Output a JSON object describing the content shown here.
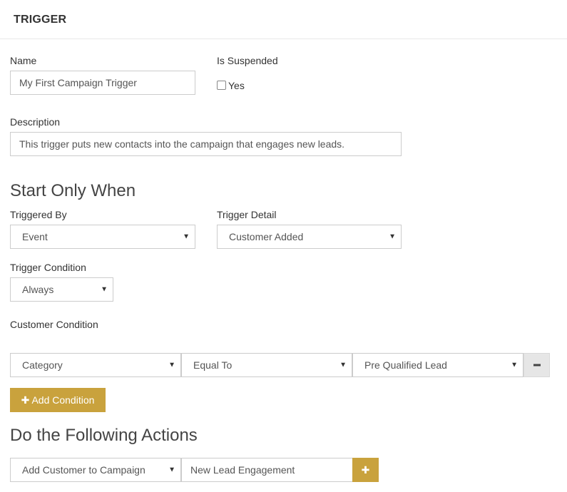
{
  "header": {
    "title": "TRIGGER"
  },
  "form": {
    "name_label": "Name",
    "name_value": "My First Campaign Trigger",
    "suspended_label": "Is Suspended",
    "suspended_option": "Yes",
    "description_label": "Description",
    "description_value": "This trigger puts new contacts into the campaign that engages new leads."
  },
  "start": {
    "title": "Start Only When",
    "triggered_by_label": "Triggered By",
    "triggered_by_value": "Event",
    "trigger_detail_label": "Trigger Detail",
    "trigger_detail_value": "Customer Added",
    "trigger_condition_label": "Trigger Condition",
    "trigger_condition_value": "Always",
    "customer_condition_label": "Customer Condition",
    "condition_row": {
      "field": "Category",
      "operator": "Equal To",
      "value": "Pre Qualified Lead"
    },
    "add_condition_label": "Add Condition"
  },
  "actions": {
    "title": "Do the Following Actions",
    "action_value": "Add Customer to Campaign",
    "campaign_value": "New Lead Engagement"
  },
  "icons": {
    "caret": "caret-down-icon",
    "plus": "plus-icon",
    "minus": "minus-icon"
  },
  "colors": {
    "accent": "#c9a23d",
    "border": "#cccccc"
  }
}
